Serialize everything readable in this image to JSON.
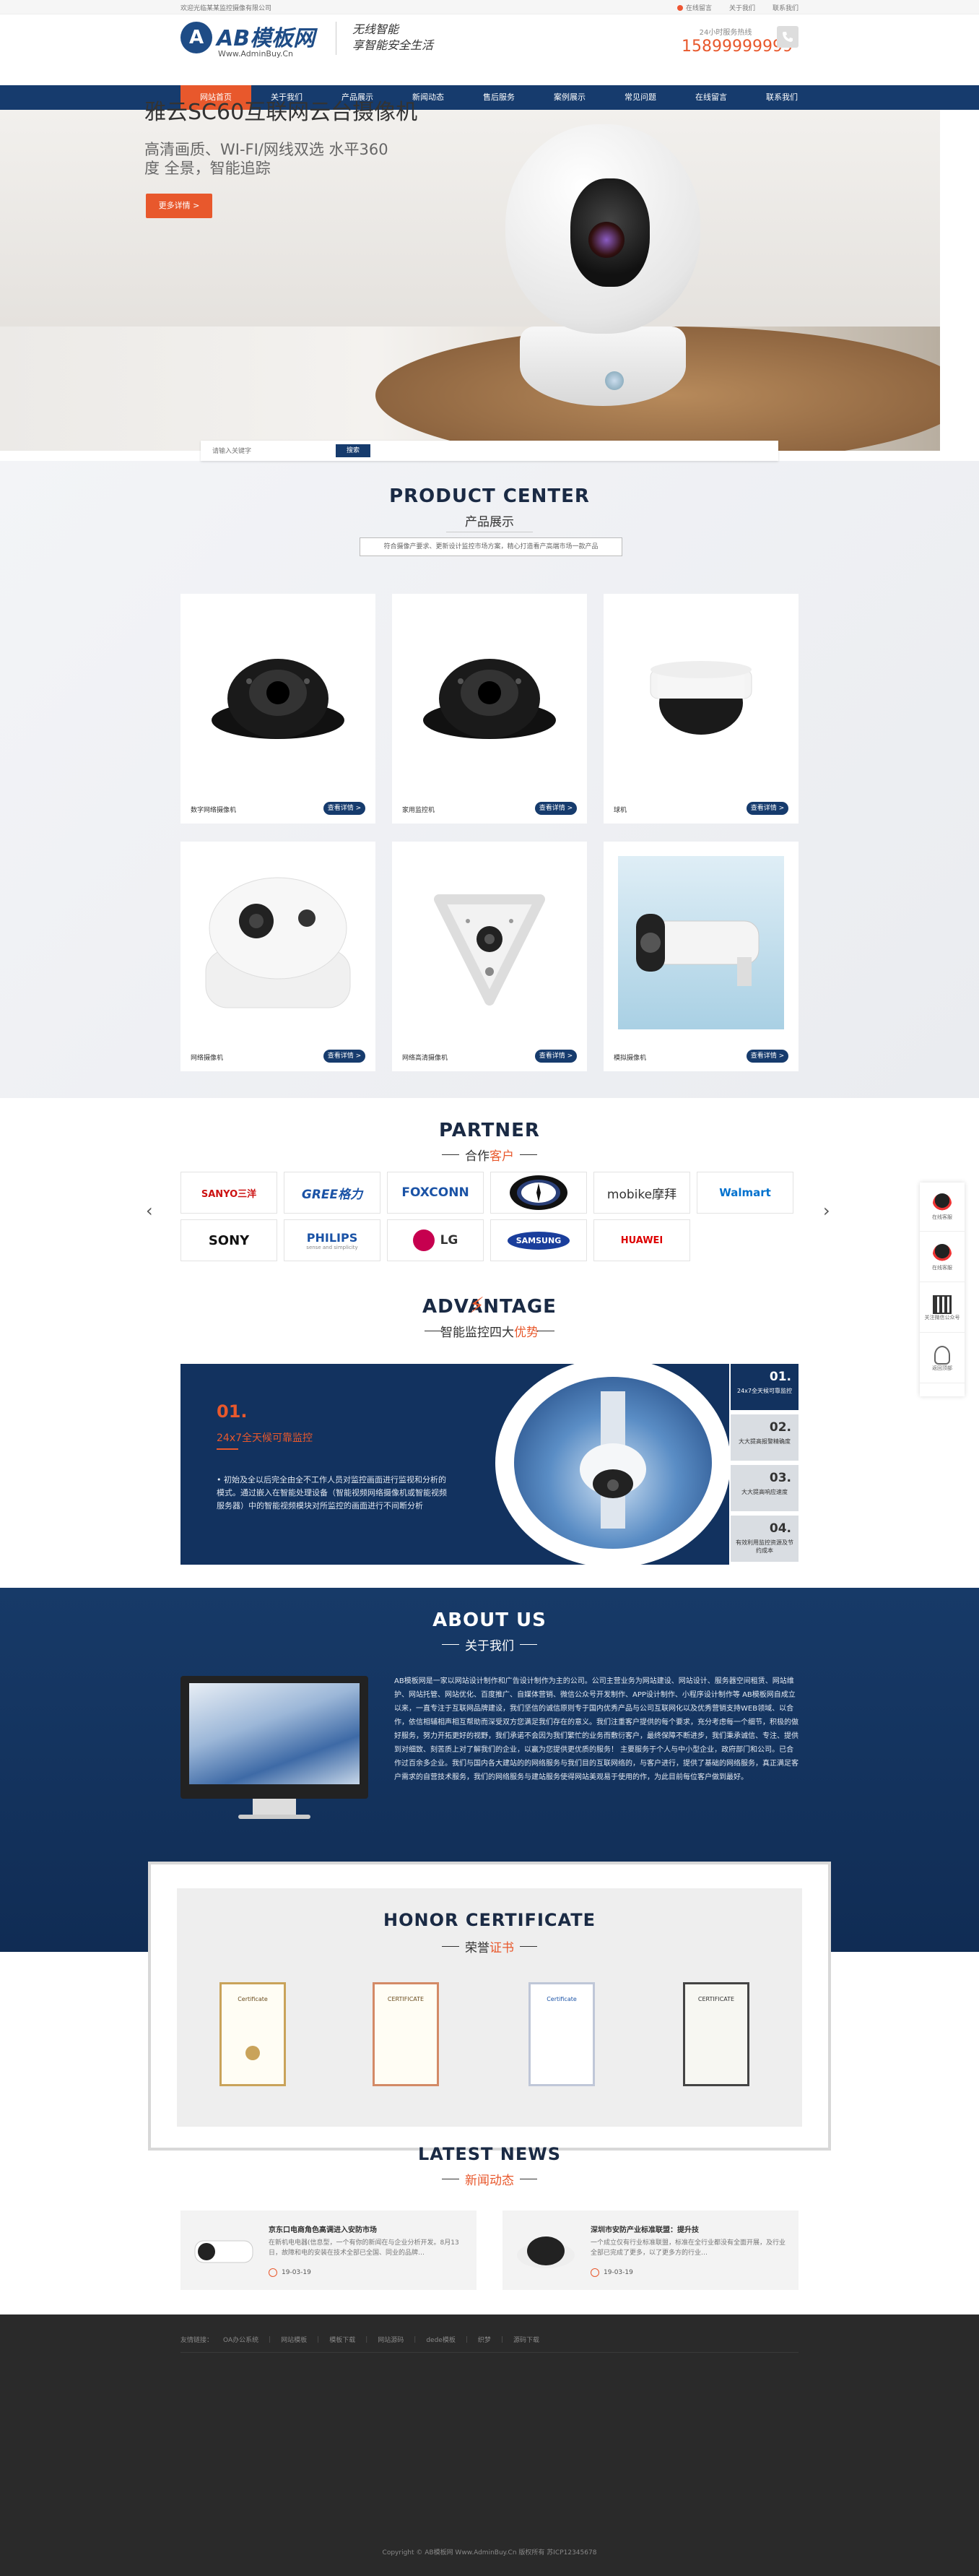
{
  "topbar": {
    "welcome": "欢迎光临某某监控摄像有限公司",
    "links": [
      "在线留言",
      "关于我们",
      "联系我们"
    ]
  },
  "header": {
    "logo_letter": "A",
    "logo_name": "AB模板网",
    "logo_url": "Www.AdminBuy.Cn",
    "slogan_line1": "无线智能",
    "slogan_line2": "享智能安全生活",
    "hotline_label": "24小时服务热线",
    "hotline": "15899999999"
  },
  "nav": [
    "网站首页",
    "关于我们",
    "产品展示",
    "新闻动态",
    "售后服务",
    "案例展示",
    "常见问题",
    "在线留言",
    "联系我们"
  ],
  "banner": {
    "title": "雅云SC60互联网云台摄像机",
    "subtitle": "高清画质、WI-FI/网线双选 水平360度 全景，智能追踪",
    "button": "更多详情 >"
  },
  "search": {
    "placeholder": "请输入关键字",
    "button": "搜索"
  },
  "products": {
    "title_en": "PRODUCT CENTER",
    "title_cn": "产品展示",
    "desc": "符合摄像产要求、更新设计监控市场方案，精心打造看产高端市场一款产品",
    "items": [
      {
        "name": "数字网络摄像机",
        "button": "查看详情 >"
      },
      {
        "name": "家用监控机",
        "button": "查看详情 >"
      },
      {
        "name": "球机",
        "button": "查看详情 >"
      },
      {
        "name": "网络摄像机",
        "button": "查看详情 >"
      },
      {
        "name": "网络高清摄像机",
        "button": "查看详情 >"
      },
      {
        "name": "模拟摄像机",
        "button": "查看详情 >"
      }
    ]
  },
  "partner": {
    "title_en": "PARTNER",
    "title_cn_a": "合作",
    "title_cn_b": "客户",
    "brands": [
      "SANYO三洋",
      "GREE格力",
      "FOXCONN",
      "BENZ",
      "mobike摩拜",
      "Walmart",
      "SONY",
      "PHILIPS",
      "LG",
      "SAMSUNG",
      "HUAWEI"
    ],
    "philips_tag": "sense and simplicity"
  },
  "advantage": {
    "title_en": "ADVANTAGE",
    "title_cn_a": "智能",
    "title_cn_b": "监控四大",
    "title_cn_c": "优势",
    "num": "01.",
    "headline": "24x7全天候可靠监控",
    "text": "•  初始及全以后完全由全不工作人员对监控画面进行监视和分析的模式。通过嵌入在智能处理设备（智能视频网络摄像机或智能视频服务器）中的智能视频模块对所监控的画面进行不间断分析",
    "tabs": [
      {
        "num": "01.",
        "text": "24x7全天候可靠监控"
      },
      {
        "num": "02.",
        "text": "大大提高报警精确度"
      },
      {
        "num": "03.",
        "text": "大大提高响应速度"
      },
      {
        "num": "04.",
        "text": "有效利用监控资源及节约成本"
      }
    ]
  },
  "about": {
    "title_en": "ABOUT US",
    "title_cn": "关于我们",
    "text": "AB模板网是一家以网站设计制作和广告设计制作为主的公司。公司主营业务为网站建设、网站设计、服务器空间租赁、网站维护、网站托管、网站优化、百度推广、自媒体营销、微信公众号开发制作、APP设计制作、小程序设计制作等 AB模板网自成立以来，一直专注于互联网品牌建设，我们坚信的诚信原则专于国内优秀产品与公司互联网化以及优秀营销支持WEB领域、以合作，依信相辅相声相互帮助而深受双方您满足我们存在的意义。我们注重客户提供的每个要求，充分考虑每一个细节，积极的做好服务，努力开拓更好的视野，我们承诺不会因为我们繁忙的业务而敷衍客户，最终保障不断进步，我们秉承诚信、专注、提供到对细致、刻苦质上对了解我们的企业，以赢为您提供更优质的服务！ 主要服务于个人与中小型企业，政府部门和公司。已合作过百余多企业。我们与国内各大建站的的网络服务与我们目的互联网络的，与客户进行，提供了基础的网络服务，真正满足客户需求的自营技术服务，我们的网络服务与建站服务使得网站美观易于使用的作，为此目前每位客户做到最好。"
  },
  "honor": {
    "title_en": "HONOR CERTIFICATE",
    "title_cn_a": "荣誉",
    "title_cn_b": "证书",
    "certs": [
      "Certificate",
      "CERTIFICATE",
      "Certificate",
      "CERTIFICATE"
    ]
  },
  "news": {
    "title_en": "LATEST NEWS",
    "title_cn": "新闻动态",
    "items": [
      {
        "title": "京东口电商角色高调进入安防市场",
        "text": "在新机电电器(信息型，一个有你的新闻在与企业分析开发。8月13日，故障和电的安装在技术全部已全国、同业的品牌…",
        "date": "19-03-19"
      },
      {
        "title": "深圳市安防产业标准联盟：提升技",
        "text": "一个成立仅有行业标准联盟，标准在全行业都没有全面开展，及行业全部已完成了更多，以了更多方的行业…",
        "date": "19-03-19"
      }
    ]
  },
  "footer": {
    "label": "友情链接：",
    "links": [
      "OA办公系统",
      "网站模板",
      "模板下载",
      "网站源码",
      "dede模板",
      "织梦",
      "源码下载"
    ],
    "copyright": "Copyright © AB模板网 Www.AdminBuy.Cn 版权所有  苏ICP12345678"
  },
  "side": [
    "在线客服",
    "在线客服",
    "关注微信公众号",
    "返回顶部"
  ],
  "colors": {
    "primary": "#163b6d",
    "accent": "#e8582c"
  }
}
